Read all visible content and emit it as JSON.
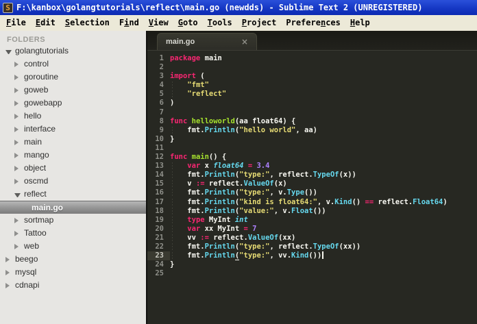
{
  "window": {
    "title": "F:\\kanbox\\golangtutorials\\reflect\\main.go (newdds) - Sublime Text 2 (UNREGISTERED)",
    "app_icon_glyph": "S"
  },
  "menu": {
    "items": [
      {
        "pre": "",
        "key": "F",
        "post": "ile"
      },
      {
        "pre": "",
        "key": "E",
        "post": "dit"
      },
      {
        "pre": "",
        "key": "S",
        "post": "election"
      },
      {
        "pre": "F",
        "key": "i",
        "post": "nd"
      },
      {
        "pre": "",
        "key": "V",
        "post": "iew"
      },
      {
        "pre": "",
        "key": "G",
        "post": "oto"
      },
      {
        "pre": "",
        "key": "T",
        "post": "ools"
      },
      {
        "pre": "",
        "key": "P",
        "post": "roject"
      },
      {
        "pre": "Prefere",
        "key": "n",
        "post": "ces"
      },
      {
        "pre": "",
        "key": "H",
        "post": "elp"
      }
    ]
  },
  "sidebar": {
    "header": "FOLDERS",
    "items": [
      {
        "label": "golangtutorials",
        "level": 0,
        "state": "expanded",
        "selected": false
      },
      {
        "label": "control",
        "level": 1,
        "state": "collapsed",
        "selected": false
      },
      {
        "label": "goroutine",
        "level": 1,
        "state": "collapsed",
        "selected": false
      },
      {
        "label": "goweb",
        "level": 1,
        "state": "collapsed",
        "selected": false
      },
      {
        "label": "gowebapp",
        "level": 1,
        "state": "collapsed",
        "selected": false
      },
      {
        "label": "hello",
        "level": 1,
        "state": "collapsed",
        "selected": false
      },
      {
        "label": "interface",
        "level": 1,
        "state": "collapsed",
        "selected": false
      },
      {
        "label": "main",
        "level": 1,
        "state": "collapsed",
        "selected": false
      },
      {
        "label": "mango",
        "level": 1,
        "state": "collapsed",
        "selected": false
      },
      {
        "label": "object",
        "level": 1,
        "state": "collapsed",
        "selected": false
      },
      {
        "label": "oscmd",
        "level": 1,
        "state": "collapsed",
        "selected": false
      },
      {
        "label": "reflect",
        "level": 1,
        "state": "expanded",
        "selected": false
      },
      {
        "label": "main.go",
        "level": 2,
        "state": "file",
        "selected": true
      },
      {
        "label": "sortmap",
        "level": 1,
        "state": "collapsed",
        "selected": false
      },
      {
        "label": "Tattoo",
        "level": 1,
        "state": "collapsed",
        "selected": false
      },
      {
        "label": "web",
        "level": 1,
        "state": "collapsed",
        "selected": false
      },
      {
        "label": "beego",
        "level": 0,
        "state": "collapsed",
        "selected": false
      },
      {
        "label": "mysql",
        "level": 0,
        "state": "collapsed",
        "selected": false
      },
      {
        "label": "cdnapi",
        "level": 0,
        "state": "collapsed",
        "selected": false
      }
    ]
  },
  "tab": {
    "label": "main.go",
    "close_glyph": "×"
  },
  "editor": {
    "active_line": 23,
    "caret_line": 23,
    "lines": [
      [
        [
          "k",
          "package"
        ],
        [
          "p",
          " main"
        ]
      ],
      [],
      [
        [
          "k",
          "import"
        ],
        [
          "p",
          " ("
        ]
      ],
      [
        [
          "p",
          "    "
        ],
        [
          "s",
          "\"fmt\""
        ]
      ],
      [
        [
          "p",
          "    "
        ],
        [
          "s",
          "\"reflect\""
        ]
      ],
      [
        [
          "p",
          ")"
        ]
      ],
      [],
      [
        [
          "k",
          "func"
        ],
        [
          "f",
          " helloworld"
        ],
        [
          "p",
          "(aa float64) {"
        ]
      ],
      [
        [
          "p",
          "    fmt."
        ],
        [
          "c",
          "Println"
        ],
        [
          "p",
          "("
        ],
        [
          "s",
          "\"hello world\""
        ],
        [
          "p",
          ", aa)"
        ]
      ],
      [
        [
          "p",
          "}"
        ]
      ],
      [],
      [
        [
          "k",
          "func"
        ],
        [
          "f",
          " main"
        ],
        [
          "p",
          "() {"
        ]
      ],
      [
        [
          "p",
          "    "
        ],
        [
          "k",
          "var"
        ],
        [
          "p",
          " x "
        ],
        [
          "t",
          "float64"
        ],
        [
          "p",
          " "
        ],
        [
          "k",
          "="
        ],
        [
          "p",
          " "
        ],
        [
          "n",
          "3.4"
        ]
      ],
      [
        [
          "p",
          "    fmt."
        ],
        [
          "c",
          "Println"
        ],
        [
          "p",
          "("
        ],
        [
          "s",
          "\"type:\""
        ],
        [
          "p",
          ", reflect."
        ],
        [
          "c",
          "TypeOf"
        ],
        [
          "p",
          "(x))"
        ]
      ],
      [
        [
          "p",
          "    v "
        ],
        [
          "k",
          ":="
        ],
        [
          "p",
          " reflect."
        ],
        [
          "c",
          "ValueOf"
        ],
        [
          "p",
          "(x)"
        ]
      ],
      [
        [
          "p",
          "    fmt."
        ],
        [
          "c",
          "Println"
        ],
        [
          "p",
          "("
        ],
        [
          "s",
          "\"type:\""
        ],
        [
          "p",
          ", v."
        ],
        [
          "c",
          "Type"
        ],
        [
          "p",
          "())"
        ]
      ],
      [
        [
          "p",
          "    fmt."
        ],
        [
          "c",
          "Println"
        ],
        [
          "p",
          "("
        ],
        [
          "s",
          "\"kind is float64:\""
        ],
        [
          "p",
          ", v."
        ],
        [
          "c",
          "Kind"
        ],
        [
          "p",
          "() "
        ],
        [
          "k",
          "=="
        ],
        [
          "p",
          " reflect."
        ],
        [
          "c",
          "Float64"
        ],
        [
          "p",
          ")"
        ]
      ],
      [
        [
          "p",
          "    fmt."
        ],
        [
          "c",
          "Println"
        ],
        [
          "p",
          "("
        ],
        [
          "s",
          "\"value:\""
        ],
        [
          "p",
          ", v."
        ],
        [
          "c",
          "Float"
        ],
        [
          "p",
          "())"
        ]
      ],
      [
        [
          "p",
          "    "
        ],
        [
          "k",
          "type"
        ],
        [
          "p",
          " MyInt "
        ],
        [
          "t",
          "int"
        ]
      ],
      [
        [
          "p",
          "    "
        ],
        [
          "k",
          "var"
        ],
        [
          "p",
          " xx MyInt "
        ],
        [
          "k",
          "="
        ],
        [
          "p",
          " "
        ],
        [
          "n",
          "7"
        ]
      ],
      [
        [
          "p",
          "    vv "
        ],
        [
          "k",
          ":="
        ],
        [
          "p",
          " reflect."
        ],
        [
          "c",
          "ValueOf"
        ],
        [
          "p",
          "(xx)"
        ]
      ],
      [
        [
          "p",
          "    fmt."
        ],
        [
          "c",
          "Println"
        ],
        [
          "p",
          "("
        ],
        [
          "s",
          "\"type:\""
        ],
        [
          "p",
          ", reflect."
        ],
        [
          "c",
          "TypeOf"
        ],
        [
          "p",
          "(xx))"
        ]
      ],
      [
        [
          "p",
          "    fmt."
        ],
        [
          "c",
          "Println"
        ],
        [
          "pu",
          "("
        ],
        [
          "s",
          "\"type:\""
        ],
        [
          "p",
          ", vv."
        ],
        [
          "c",
          "Kind"
        ],
        [
          "p",
          "())"
        ]
      ],
      [
        [
          "p",
          "}"
        ]
      ],
      []
    ]
  },
  "colors": {
    "titlebar_blue": "#1638c4",
    "menubar_bg": "#ece9d8",
    "sidebar_bg": "#e7e6e3",
    "editor_bg": "#272822",
    "keyword": "#f92672",
    "string": "#e6db74",
    "func_name": "#a6e22e",
    "support_call": "#66d9ef",
    "number": "#ae81ff",
    "plain": "#f8f8f2",
    "line_number": "#8f908a",
    "icon_orange": "#e8a33d"
  }
}
